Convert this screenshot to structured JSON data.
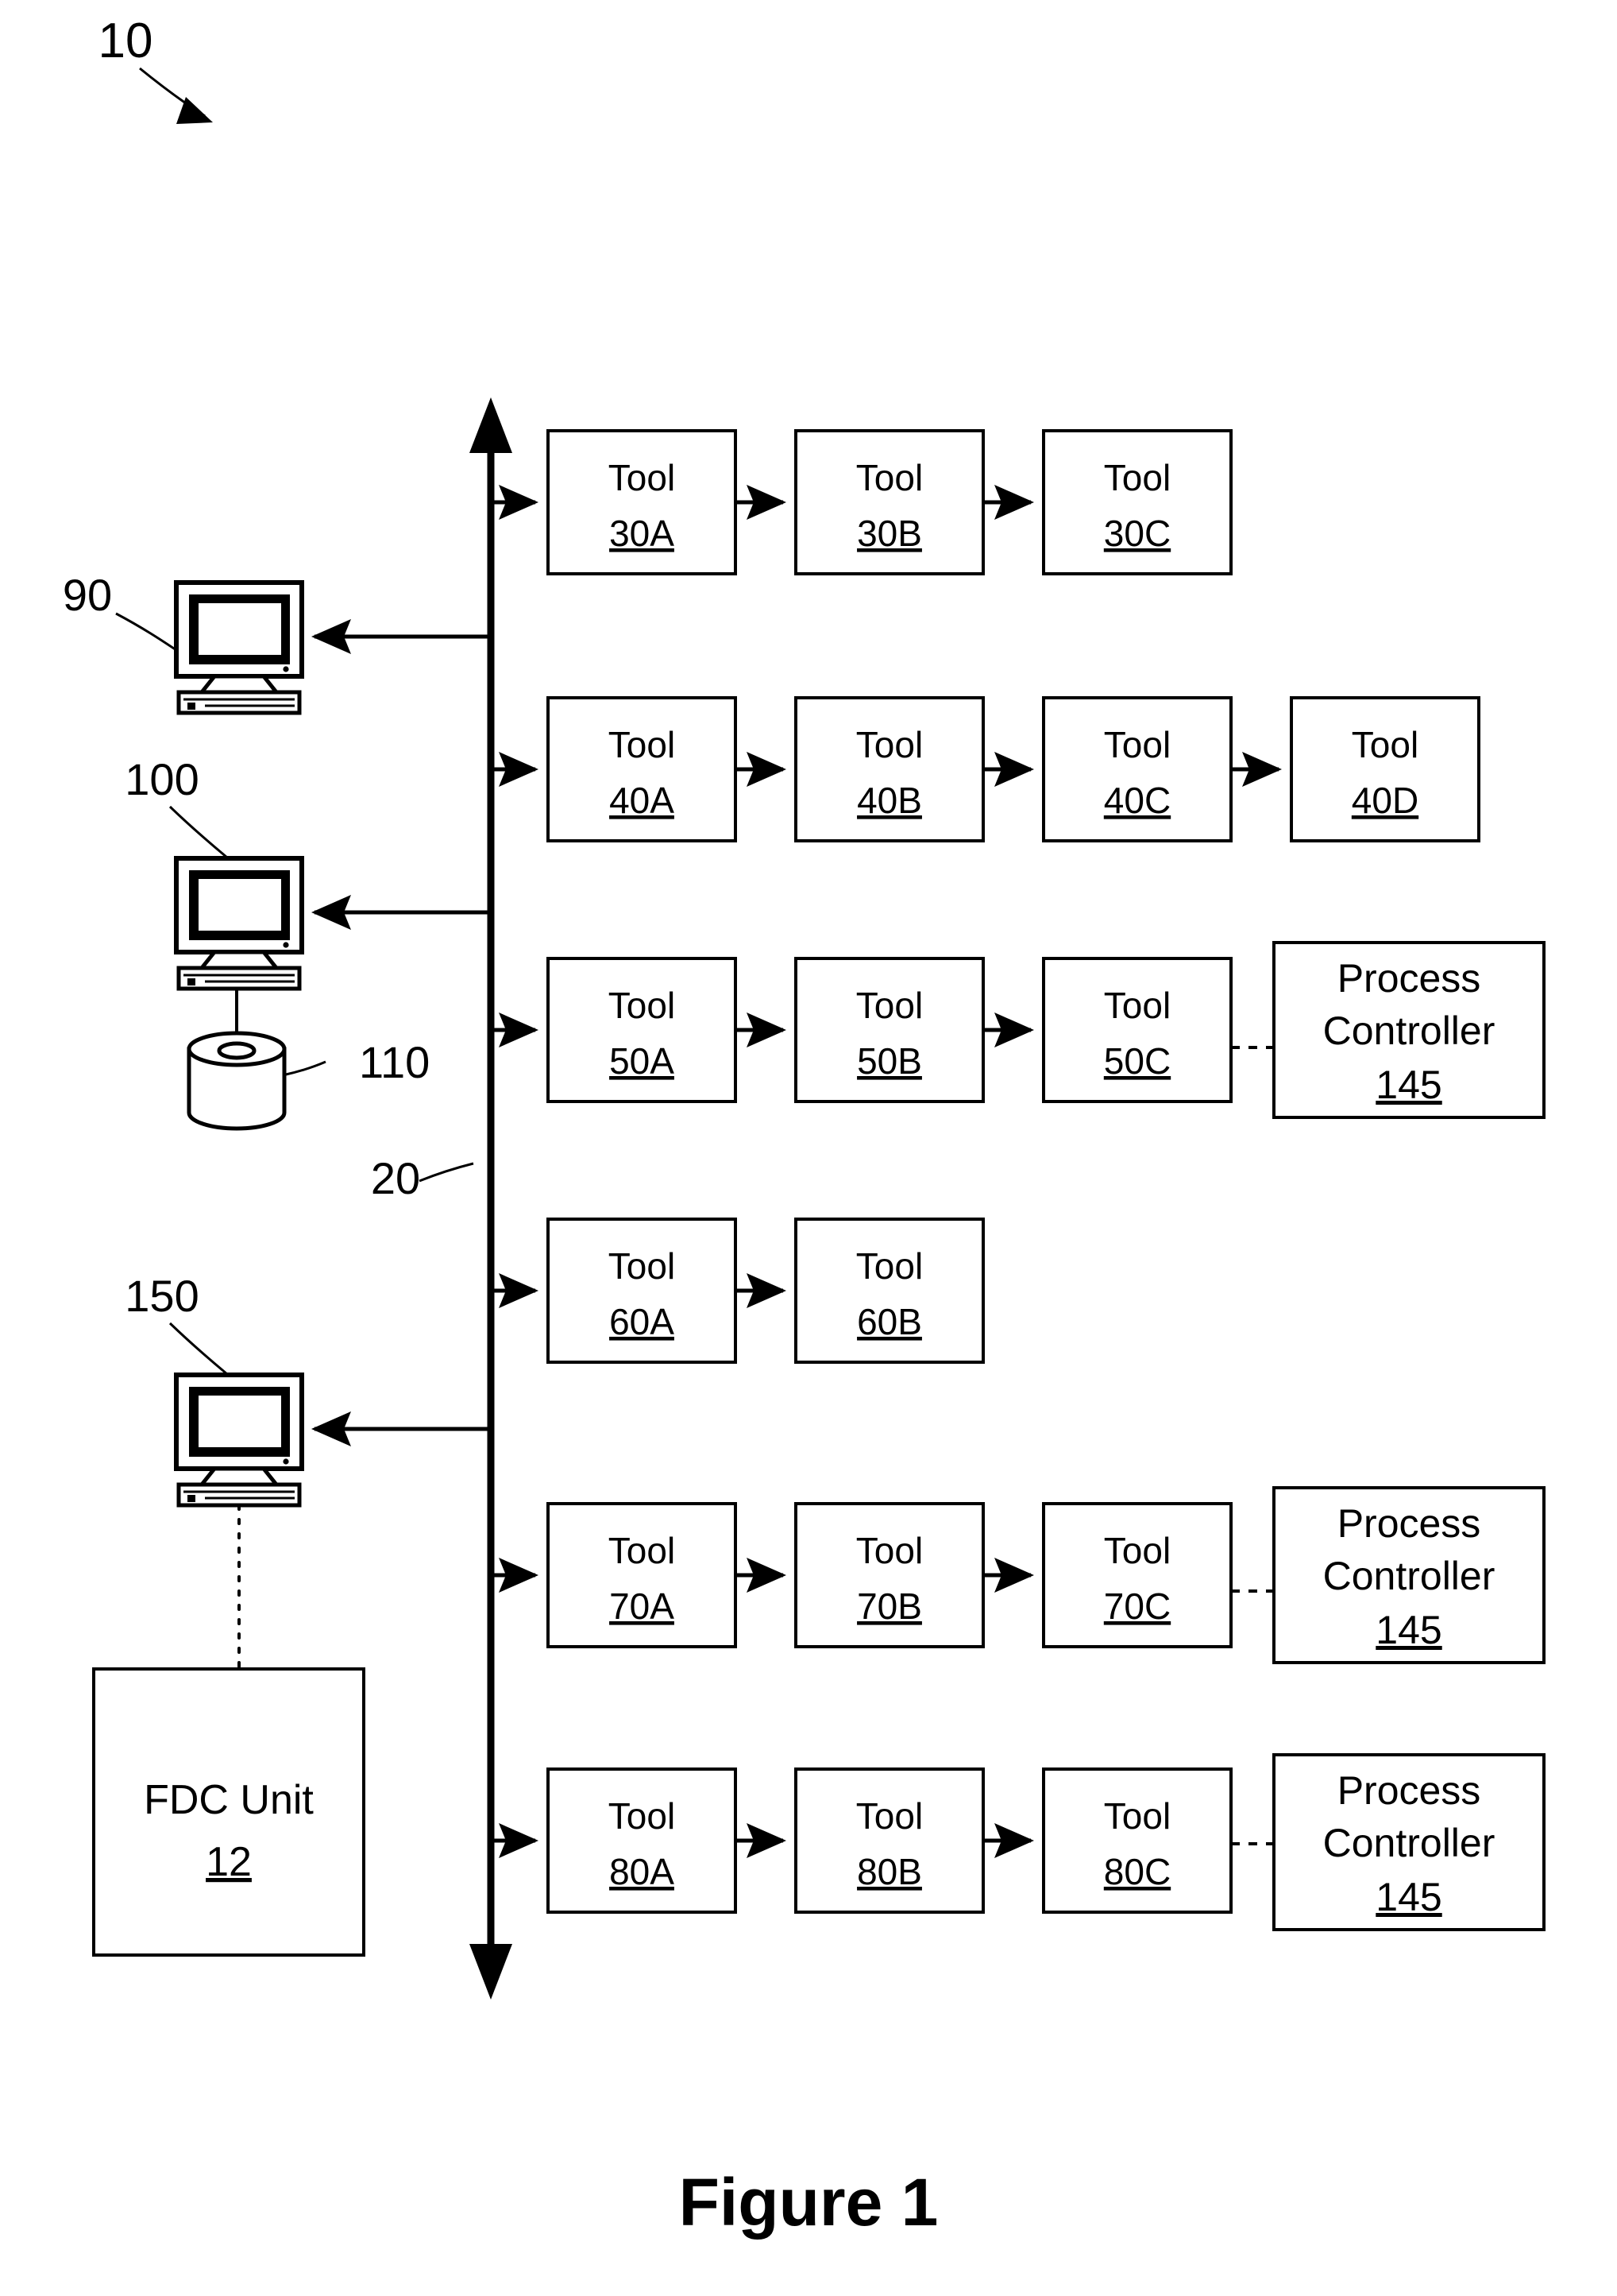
{
  "figure": {
    "caption": "Figure 1",
    "system_ref": "10",
    "bus_ref": "20"
  },
  "bus": {
    "label": "20",
    "orientation": "vertical",
    "arrow_top": true,
    "arrow_bottom": true
  },
  "left_column": {
    "computers": [
      {
        "ref": "90",
        "name": "workstation-90",
        "icon": "computer-icon",
        "has_database": false,
        "has_fdc": false
      },
      {
        "ref": "100",
        "name": "workstation-100",
        "icon": "computer-icon",
        "has_database": true,
        "has_fdc": false
      },
      {
        "ref": "150",
        "name": "workstation-150",
        "icon": "computer-icon",
        "has_database": false,
        "has_fdc": true
      }
    ],
    "database": {
      "ref": "110",
      "icon": "database-cylinder-icon"
    },
    "fdc_unit": {
      "label": "FDC Unit",
      "ref": "12"
    }
  },
  "tool_rows": [
    {
      "row_id": "row-30",
      "tools": [
        {
          "label": "Tool",
          "ref": "30A"
        },
        {
          "label": "Tool",
          "ref": "30B"
        },
        {
          "label": "Tool",
          "ref": "30C"
        }
      ],
      "controller": null,
      "feedback_arrow": true
    },
    {
      "row_id": "row-40",
      "tools": [
        {
          "label": "Tool",
          "ref": "40A"
        },
        {
          "label": "Tool",
          "ref": "40B"
        },
        {
          "label": "Tool",
          "ref": "40C"
        },
        {
          "label": "Tool",
          "ref": "40D"
        }
      ],
      "controller": null,
      "feedback_arrow": false
    },
    {
      "row_id": "row-50",
      "tools": [
        {
          "label": "Tool",
          "ref": "50A"
        },
        {
          "label": "Tool",
          "ref": "50B"
        },
        {
          "label": "Tool",
          "ref": "50C"
        }
      ],
      "controller": {
        "line1": "Process",
        "line2": "Controller",
        "ref": "145"
      },
      "feedback_arrow": false
    },
    {
      "row_id": "row-60",
      "tools": [
        {
          "label": "Tool",
          "ref": "60A"
        },
        {
          "label": "Tool",
          "ref": "60B"
        }
      ],
      "controller": null,
      "feedback_arrow": false
    },
    {
      "row_id": "row-70",
      "tools": [
        {
          "label": "Tool",
          "ref": "70A"
        },
        {
          "label": "Tool",
          "ref": "70B"
        },
        {
          "label": "Tool",
          "ref": "70C"
        }
      ],
      "controller": {
        "line1": "Process",
        "line2": "Controller",
        "ref": "145"
      },
      "feedback_arrow": true
    },
    {
      "row_id": "row-80",
      "tools": [
        {
          "label": "Tool",
          "ref": "80A"
        },
        {
          "label": "Tool",
          "ref": "80B"
        },
        {
          "label": "Tool",
          "ref": "80C"
        }
      ],
      "controller": {
        "line1": "Process",
        "line2": "Controller",
        "ref": "145"
      },
      "feedback_arrow": false
    }
  ],
  "colors": {
    "ink": "#000000",
    "paper": "#ffffff"
  }
}
